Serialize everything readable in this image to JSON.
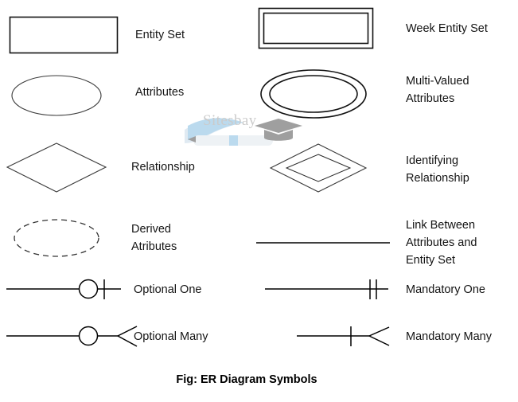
{
  "figure": {
    "caption": "Fig: ER Diagram Symbols",
    "watermark": "Sitesbay",
    "background_color": "#ffffff",
    "stroke_color": "#333333"
  },
  "symbols": {
    "entity_set": {
      "label": "Entity Set",
      "shape": "rectangle"
    },
    "weak_entity_set": {
      "label": "Week Entity Set",
      "shape": "double-rectangle"
    },
    "attributes": {
      "label": "Attributes",
      "shape": "ellipse"
    },
    "multi_valued_attributes": {
      "label_line1": "Multi-Valued",
      "label_line2": "Attributes",
      "shape": "double-ellipse"
    },
    "relationship": {
      "label": "Relationship",
      "shape": "diamond"
    },
    "identifying_relationship": {
      "label_line1": "Identifying",
      "label_line2": "Relationship",
      "shape": "double-diamond"
    },
    "derived_attributes": {
      "label_line1": "Derived",
      "label_line2": "Atributes",
      "shape": "dashed-ellipse"
    },
    "link": {
      "label_line1": "Link Between",
      "label_line2": "Attributes and",
      "label_line3": "Entity Set",
      "shape": "line"
    },
    "optional_one": {
      "label": "Optional One",
      "shape": "line-circle-tick"
    },
    "mandatory_one": {
      "label": "Mandatory One",
      "shape": "line-tick-tick"
    },
    "optional_many": {
      "label": "Optional Many",
      "shape": "line-circle-crowsfoot"
    },
    "mandatory_many": {
      "label": "Mandatory Many",
      "shape": "line-tick-crowsfoot"
    }
  }
}
